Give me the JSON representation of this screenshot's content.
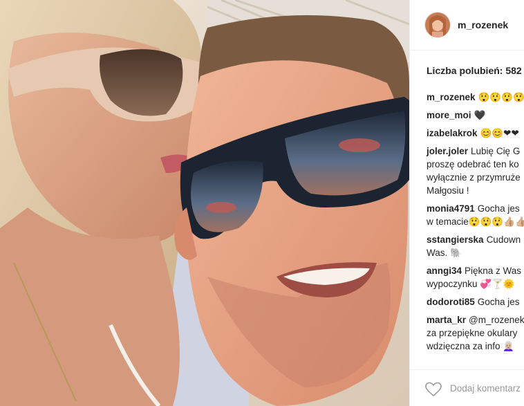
{
  "post": {
    "username": "m_rozenek",
    "likes_text": "Liczba polubień: 582",
    "add_comment_placeholder": "Dodaj komentarz",
    "heart_icon": "heart-outline-icon"
  },
  "comments": [
    {
      "author": "m_rozenek",
      "lines": [
        "😲😲😲😲"
      ]
    },
    {
      "author": "more_moi",
      "lines": [
        "🖤"
      ]
    },
    {
      "author": "izabelakrok",
      "lines": [
        "😊😊❤❤"
      ]
    },
    {
      "author": "joler.joler",
      "lines": [
        "Lubię Cię G",
        "proszę odebrać ten ko",
        "wyłącznie z przymruże",
        "Małgosiu !"
      ]
    },
    {
      "author": "monia4791",
      "lines": [
        "Gocha jes",
        "w temacie😲😲😲👍🏼👍🏼"
      ]
    },
    {
      "author": "sstangierska",
      "lines": [
        "Cudown",
        "Was. 🐘"
      ]
    },
    {
      "author": "anngi34",
      "lines": [
        "Piękna z Was",
        "wypoczynku 💞🍸🌞"
      ]
    },
    {
      "author": "dodoroti85",
      "lines": [
        "Gocha jes"
      ]
    },
    {
      "author": "marta_kr",
      "lines": [
        "@m_rozenek",
        "za przepiękne okulary",
        "wdzięczna za info 👩🏼‍🦳"
      ]
    }
  ],
  "colors": {
    "text": "#262626",
    "muted": "#999999",
    "divider": "#efefef"
  }
}
